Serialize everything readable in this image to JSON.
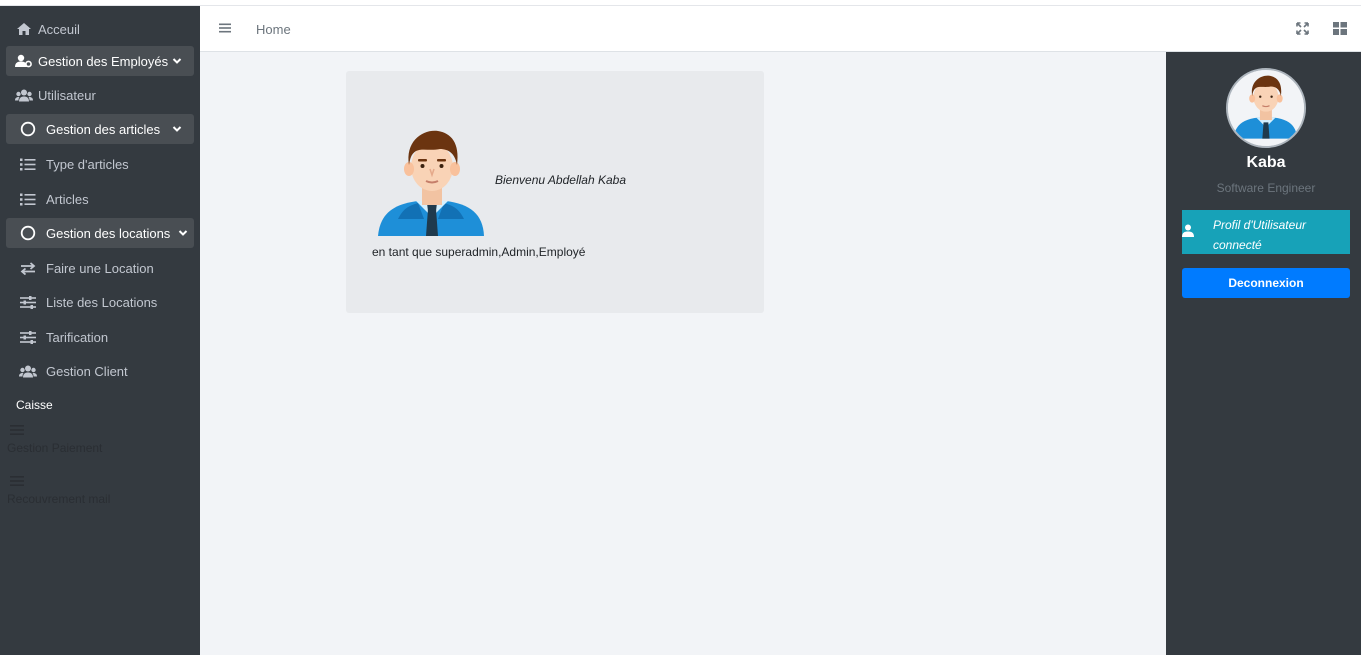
{
  "colors": {
    "sidebar_bg": "#343a40",
    "profile_accent": "#17a2b8",
    "logout_bg": "#007bff",
    "main_bg": "#f2f4f7"
  },
  "sidebar": {
    "items": [
      {
        "label": "Acceuil",
        "icon": "home-icon"
      },
      {
        "label": "Gestion des Employés",
        "icon": "user-gear-icon"
      },
      {
        "label": "Utilisateur",
        "icon": "users-icon"
      },
      {
        "label": "Gestion des articles",
        "icon": "circle-icon"
      },
      {
        "label": "Type d'articles",
        "icon": "list-icon"
      },
      {
        "label": "Articles",
        "icon": "list-icon"
      },
      {
        "label": "Gestion des locations",
        "icon": "circle-icon"
      },
      {
        "label": "Faire une Location",
        "icon": "exchange-icon"
      },
      {
        "label": "Liste des Locations",
        "icon": "sliders-icon"
      },
      {
        "label": "Tarification",
        "icon": "sliders-icon"
      },
      {
        "label": "Gestion Client",
        "icon": "users-icon"
      }
    ],
    "caisse": "Caisse",
    "muted": [
      "Gestion Paiement",
      "Recouvrement mail"
    ]
  },
  "header": {
    "breadcrumb": "Home",
    "menu_icon": "hamburger-icon",
    "expand_icon": "expand-icon",
    "grid_icon": "grid-icon"
  },
  "main": {
    "welcome": "Bienvenu Abdellah Kaba",
    "role": "en tant que superadmin,Admin,Employé"
  },
  "profile": {
    "name": "Kaba",
    "job": "Software Engineer",
    "profile_link": "Profil d'Utilisateur connecté",
    "logout": "Deconnexion"
  }
}
